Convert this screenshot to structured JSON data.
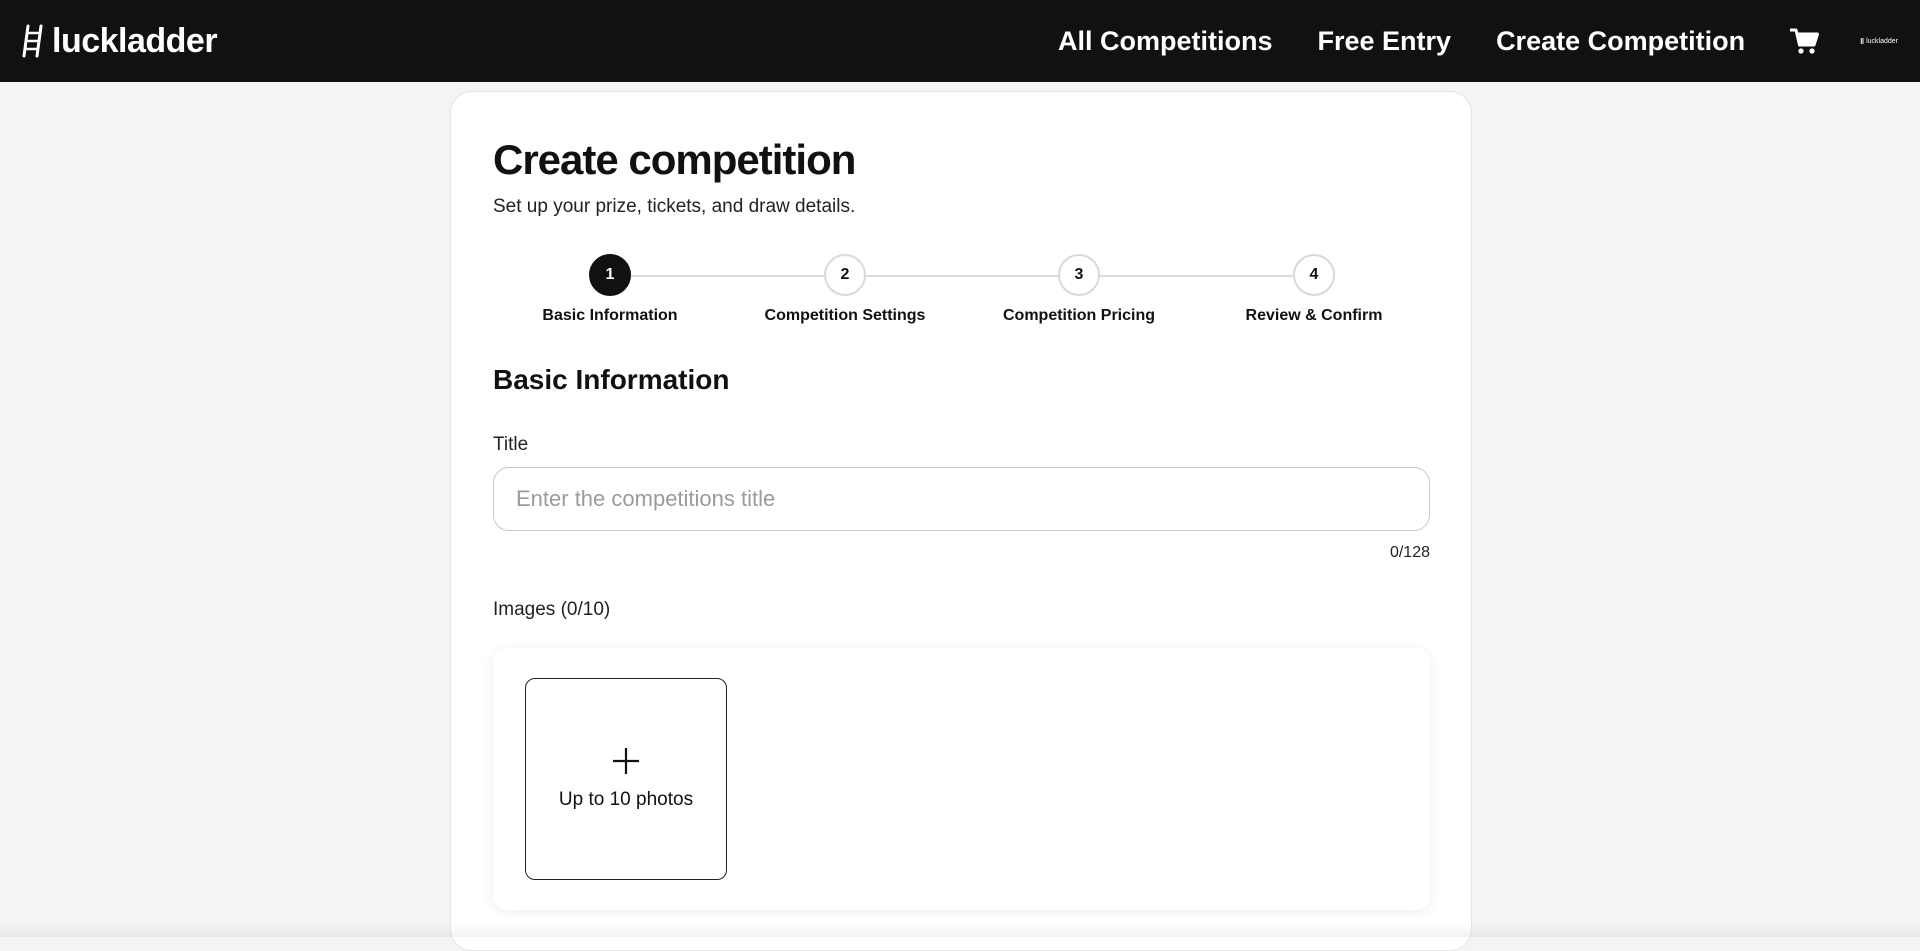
{
  "header": {
    "brand": "luckladder",
    "brand_icon": "ladder-icon",
    "nav": [
      {
        "label": "All Competitions"
      },
      {
        "label": "Free Entry"
      },
      {
        "label": "Create Competition"
      }
    ],
    "cart_icon": "cart-icon",
    "mini_logo": "luckladder"
  },
  "page": {
    "title": "Create competition",
    "subtitle": "Set up your prize, tickets, and draw details."
  },
  "stepper": {
    "current_step": 1,
    "steps": [
      {
        "number": "1",
        "label": "Basic Information"
      },
      {
        "number": "2",
        "label": "Competition Settings"
      },
      {
        "number": "3",
        "label": "Competition Pricing"
      },
      {
        "number": "4",
        "label": "Review & Confirm"
      }
    ]
  },
  "form": {
    "section_title": "Basic Information",
    "title_field": {
      "label": "Title",
      "value": "",
      "placeholder": "Enter the competitions title",
      "counter": "0/128"
    },
    "images": {
      "label": "Images (0/10)",
      "upload_text": "Up to 10 photos"
    }
  },
  "colors": {
    "header_bg": "#111111",
    "page_bg": "#f5f3f3",
    "accent": "#111111",
    "step_inactive_border": "#d9d9d9"
  }
}
